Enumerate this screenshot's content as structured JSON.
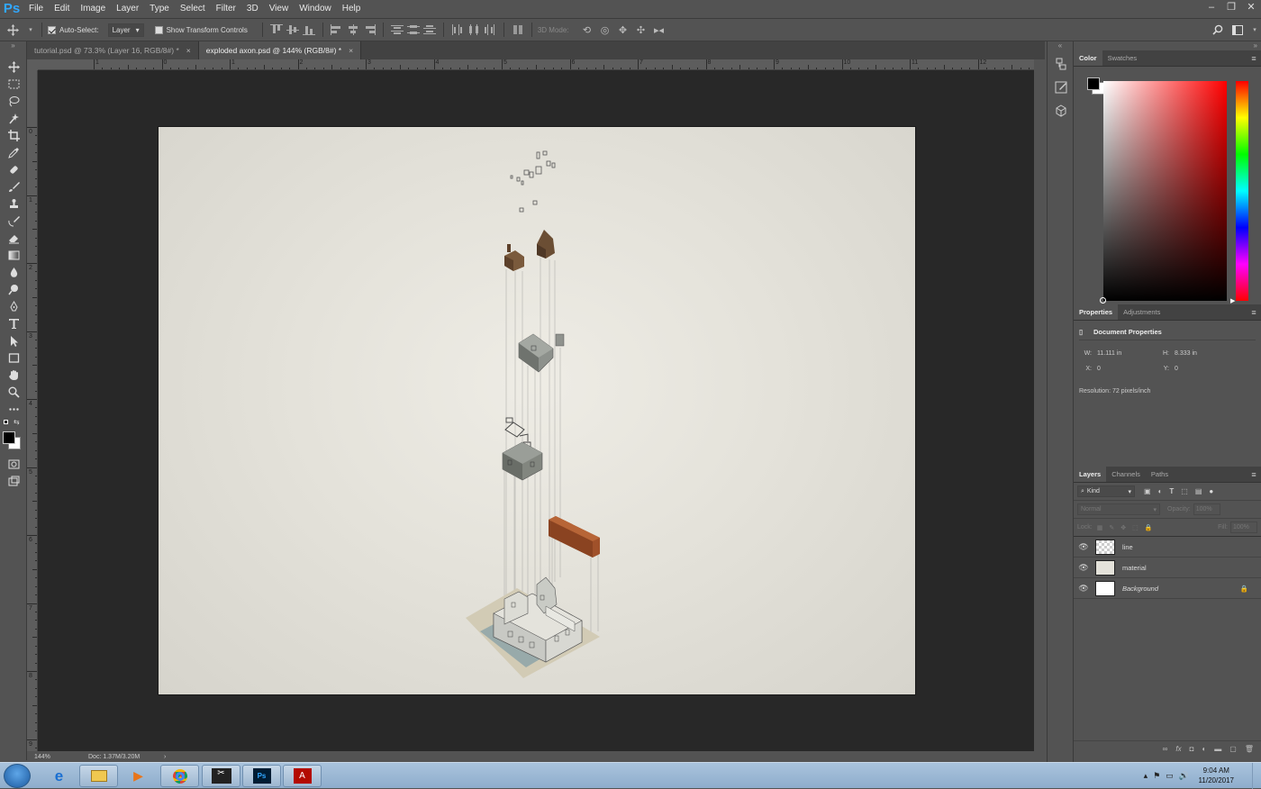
{
  "app": {
    "logo": "Ps"
  },
  "menu": [
    "File",
    "Edit",
    "Image",
    "Layer",
    "Type",
    "Select",
    "Filter",
    "3D",
    "View",
    "Window",
    "Help"
  ],
  "options_bar": {
    "auto_select_label": "Auto-Select:",
    "auto_select_checked": true,
    "auto_select_target": "Layer",
    "show_transform_label": "Show Transform Controls",
    "mode_label": "3D Mode:"
  },
  "tabs": [
    {
      "label": "tutorial.psd @ 73.3% (Layer 16, RGB/8#) *",
      "active": false
    },
    {
      "label": "exploded axon.psd @ 144% (RGB/8#) *",
      "active": true
    }
  ],
  "ruler_h": [
    "1",
    "0",
    "1",
    "2",
    "3",
    "4",
    "5",
    "6",
    "7",
    "8",
    "9",
    "10",
    "11",
    "12"
  ],
  "ruler_v": [
    "0",
    "1",
    "2",
    "3",
    "4",
    "5",
    "6",
    "7",
    "8",
    "9"
  ],
  "status": {
    "zoom": "144%",
    "doc": "Doc: 1.37M/3.20M"
  },
  "color_panel": {
    "tabs": [
      "Color",
      "Swatches"
    ],
    "hue_color": "#ff0000"
  },
  "properties_panel": {
    "tabs": [
      "Properties",
      "Adjustments"
    ],
    "title": "Document Properties",
    "w_label": "W:",
    "w_value": "11.111 in",
    "h_label": "H:",
    "h_value": "8.333 in",
    "x_label": "X:",
    "x_value": "0",
    "y_label": "Y:",
    "y_value": "0",
    "resolution": "Resolution: 72 pixels/inch"
  },
  "layers_panel": {
    "tabs": [
      "Layers",
      "Channels",
      "Paths"
    ],
    "filter": "Kind",
    "blend_mode": "Normal",
    "opacity_label": "Opacity:",
    "opacity_value": "100%",
    "lock_label": "Lock:",
    "fill_label": "Fill:",
    "fill_value": "100%",
    "layers": [
      {
        "name": "line"
      },
      {
        "name": "material"
      },
      {
        "name": "Background"
      }
    ]
  },
  "taskbar": {
    "time": "9:04 AM",
    "date": "11/20/2017"
  }
}
